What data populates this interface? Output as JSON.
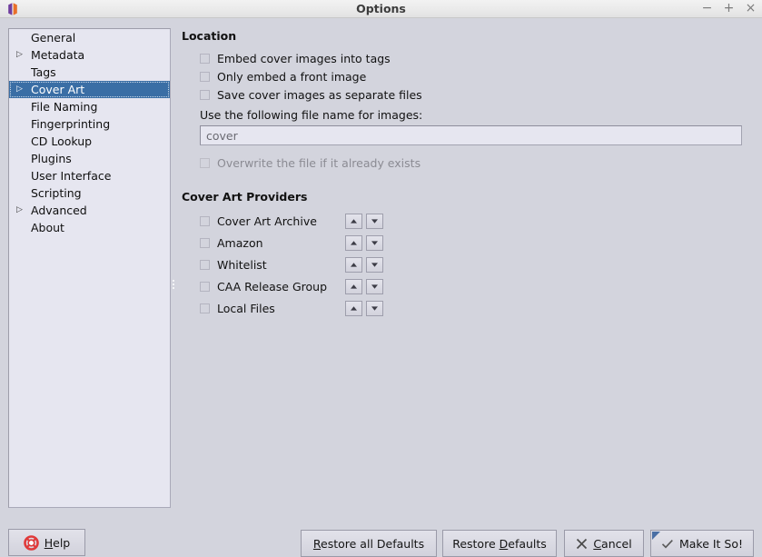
{
  "window": {
    "title": "Options",
    "app_icon": "picard-logo-icon",
    "controls": [
      {
        "name": "minimize-button",
        "glyph": "−"
      },
      {
        "name": "maximize-button",
        "glyph": "+"
      },
      {
        "name": "close-button",
        "glyph": "×"
      }
    ]
  },
  "sidebar": {
    "items": [
      {
        "label": "General",
        "expandable": false,
        "selected": false
      },
      {
        "label": "Metadata",
        "expandable": true,
        "selected": false
      },
      {
        "label": "Tags",
        "expandable": false,
        "selected": false
      },
      {
        "label": "Cover Art",
        "expandable": true,
        "selected": true
      },
      {
        "label": "File Naming",
        "expandable": false,
        "selected": false
      },
      {
        "label": "Fingerprinting",
        "expandable": false,
        "selected": false
      },
      {
        "label": "CD Lookup",
        "expandable": false,
        "selected": false
      },
      {
        "label": "Plugins",
        "expandable": false,
        "selected": false
      },
      {
        "label": "User Interface",
        "expandable": false,
        "selected": false
      },
      {
        "label": "Scripting",
        "expandable": false,
        "selected": false
      },
      {
        "label": "Advanced",
        "expandable": true,
        "selected": false
      },
      {
        "label": "About",
        "expandable": false,
        "selected": false
      }
    ],
    "expand_arrow": "▷"
  },
  "location": {
    "title": "Location",
    "checkboxes": [
      {
        "label": "Embed cover images into tags",
        "checked": false,
        "disabled": false
      },
      {
        "label": "Only embed a front image",
        "checked": false,
        "disabled": false
      },
      {
        "label": "Save cover images as separate files",
        "checked": false,
        "disabled": false
      }
    ],
    "filename_label": "Use the following file name for images:",
    "filename_value": "cover",
    "filename_placeholder": "cover",
    "overwrite": {
      "label": "Overwrite the file if it already exists",
      "checked": false,
      "disabled": true
    }
  },
  "providers": {
    "title": "Cover Art Providers",
    "up_arrow": "▲",
    "down_arrow": "▼",
    "items": [
      {
        "label": "Cover Art Archive",
        "checked": false
      },
      {
        "label": "Amazon",
        "checked": false
      },
      {
        "label": "Whitelist",
        "checked": false
      },
      {
        "label": "CAA Release Group",
        "checked": false
      },
      {
        "label": "Local Files",
        "checked": false
      }
    ]
  },
  "buttons": {
    "help": {
      "pre": "",
      "mnemonic": "H",
      "post": "elp",
      "icon": "lifesaver-icon"
    },
    "restore_all": {
      "pre": "",
      "mnemonic": "R",
      "post": "estore all Defaults",
      "icon": ""
    },
    "restore": {
      "pre": "Restore ",
      "mnemonic": "D",
      "post": "efaults",
      "icon": ""
    },
    "cancel": {
      "pre": "",
      "mnemonic": "C",
      "post": "ancel",
      "icon": "cross-icon"
    },
    "ok": {
      "pre": "Make It So!",
      "mnemonic": "",
      "post": "",
      "icon": "check-icon"
    }
  },
  "colors": {
    "background": "#d3d4dd",
    "selection": "#3a6ea5",
    "field": "#e6e6f0",
    "accent_default": "#4a6fa5",
    "help_icon": "#e03a3a"
  }
}
